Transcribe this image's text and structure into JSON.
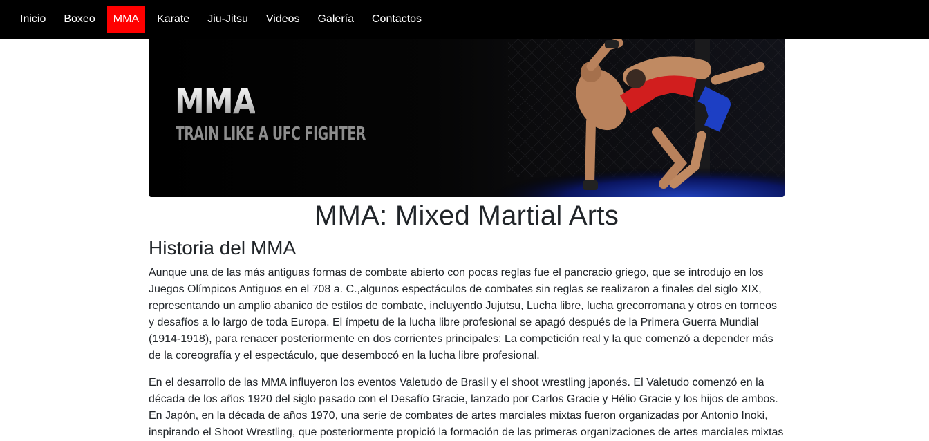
{
  "nav": {
    "items": [
      {
        "label": "Inicio",
        "active": false
      },
      {
        "label": "Boxeo",
        "active": false
      },
      {
        "label": "MMA",
        "active": true
      },
      {
        "label": "Karate",
        "active": false
      },
      {
        "label": "Jiu-Jitsu",
        "active": false
      },
      {
        "label": "Videos",
        "active": false
      },
      {
        "label": "Galería",
        "active": false
      },
      {
        "label": "Contactos",
        "active": false
      }
    ],
    "active_color": "#ff0000",
    "background": "#000000"
  },
  "banner": {
    "title": "MMA",
    "subtitle": "TRAIN LIKE A UFC FIGHTER"
  },
  "page": {
    "title": "MMA: Mixed Martial Arts",
    "section_title": "Historia del MMA",
    "paragraphs": [
      "Aunque una de las más antiguas formas de combate abierto con pocas reglas fue el pancracio griego, que se introdujo en los Juegos Olímpicos Antiguos en el 708 a. C.,algunos espectáculos de combates sin reglas se realizaron a finales del siglo XIX, representando un amplio abanico de estilos de combate, incluyendo Jujutsu, Lucha libre, lucha grecorromana y otros en torneos y desafíos a lo largo de toda Europa. El ímpetu de la lucha libre profesional se apagó después de la Primera Guerra Mundial (1914-1918), para renacer posteriormente en dos corrientes principales: La competición real y la que comenzó a depender más de la coreografía y el espectáculo, que desembocó en la lucha libre profesional.",
      "En el desarrollo de las MMA influyeron los eventos Valetudo de Brasil y el shoot wrestling japonés. El Valetudo comenzó en la década de los años 1920 del siglo pasado con el Desafío Gracie, lanzado por Carlos Gracie y Hélio Gracie y los hijos de ambos. En Japón, en la década de años 1970, una serie de combates de artes marciales mixtas fueron organizadas por Antonio Inoki, inspirando el Shoot Wrestling, que posteriormente propició la formación de las primeras organizaciones de artes marciales mixtas"
    ]
  }
}
